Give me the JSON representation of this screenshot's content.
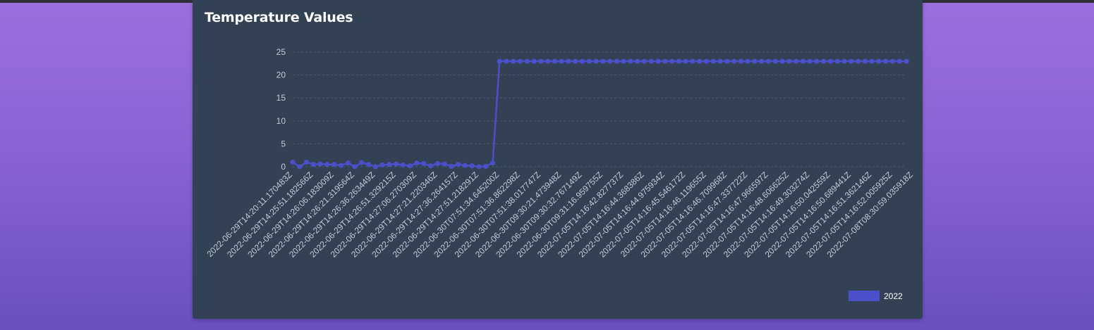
{
  "panel": {
    "title": "Temperature Values"
  },
  "chart_data": {
    "type": "line",
    "title": "Temperature Values",
    "xlabel": "",
    "ylabel": "",
    "ylim": [
      0,
      25
    ],
    "y_ticks": [
      0,
      5,
      10,
      15,
      20,
      25
    ],
    "grid": true,
    "legend_position": "bottom-right",
    "colors": {
      "series": "#4b4fc9",
      "grid": "#4a5a70",
      "tick": "#c5ccd6"
    },
    "x_tick_labels": [
      "2022-06-29T14:20:11.170483Z",
      "2022-06-29T14:25:51.182566Z",
      "2022-06-29T14:26:06.183009Z",
      "2022-06-29T14:26:21.319564Z",
      "2022-06-29T14:26:36.263449Z",
      "2022-06-29T14:26:51.329215Z",
      "2022-06-29T14:27:06.270309Z",
      "2022-06-29T14:27:21.220346Z",
      "2022-06-29T14:27:36.264157Z",
      "2022-06-29T14:27:51.218291Z",
      "2022-06-30T07:51:34.645200Z",
      "2022-06-30T07:51:36.862298Z",
      "2022-06-30T07:51:38.017747Z",
      "2022-06-30T09:30:21.473948Z",
      "2022-06-30T09:30:32.767149Z",
      "2022-06-30T09:31:16.959755Z",
      "2022-07-05T14:16:42.827737Z",
      "2022-07-05T14:16:44.368386Z",
      "2022-07-05T14:16:44.975934Z",
      "2022-07-05T14:16:45.546172Z",
      "2022-07-05T14:16:46.119655Z",
      "2022-07-05T14:16:46.709968Z",
      "2022-07-05T14:16:47.337722Z",
      "2022-07-05T14:16:47.966597Z",
      "2022-07-05T14:16:48.606625Z",
      "2022-07-05T14:16:49.303274Z",
      "2022-07-05T14:16:50.042559Z",
      "2022-07-05T14:16:50.689441Z",
      "2022-07-05T14:16:51.362146Z",
      "2022-07-05T14:16:52.005925Z",
      "2022-07-08T08:30:59.035918Z"
    ],
    "series": [
      {
        "name": "2022",
        "values": [
          1,
          0,
          1,
          0.5,
          0.6,
          0.5,
          0.5,
          0.3,
          0.8,
          0,
          0.9,
          0.5,
          0,
          0.4,
          0.5,
          0.6,
          0.4,
          0.2,
          0.8,
          0.7,
          0.2,
          0.7,
          0.6,
          0.1,
          0.5,
          0.3,
          0.2,
          0,
          0.1,
          0.8,
          23,
          23,
          23,
          23,
          23,
          23,
          23,
          23,
          23,
          23,
          23,
          23,
          23,
          23,
          23,
          23,
          23,
          23,
          23,
          23,
          23,
          23,
          23,
          23,
          23,
          23,
          23,
          23,
          23,
          23,
          23,
          23,
          23,
          23,
          23,
          23,
          23,
          23,
          23,
          23,
          23,
          23,
          23,
          23,
          23,
          23,
          23,
          23,
          23,
          23,
          23,
          23,
          23,
          23,
          23,
          23,
          23,
          23,
          23,
          23
        ]
      }
    ]
  }
}
